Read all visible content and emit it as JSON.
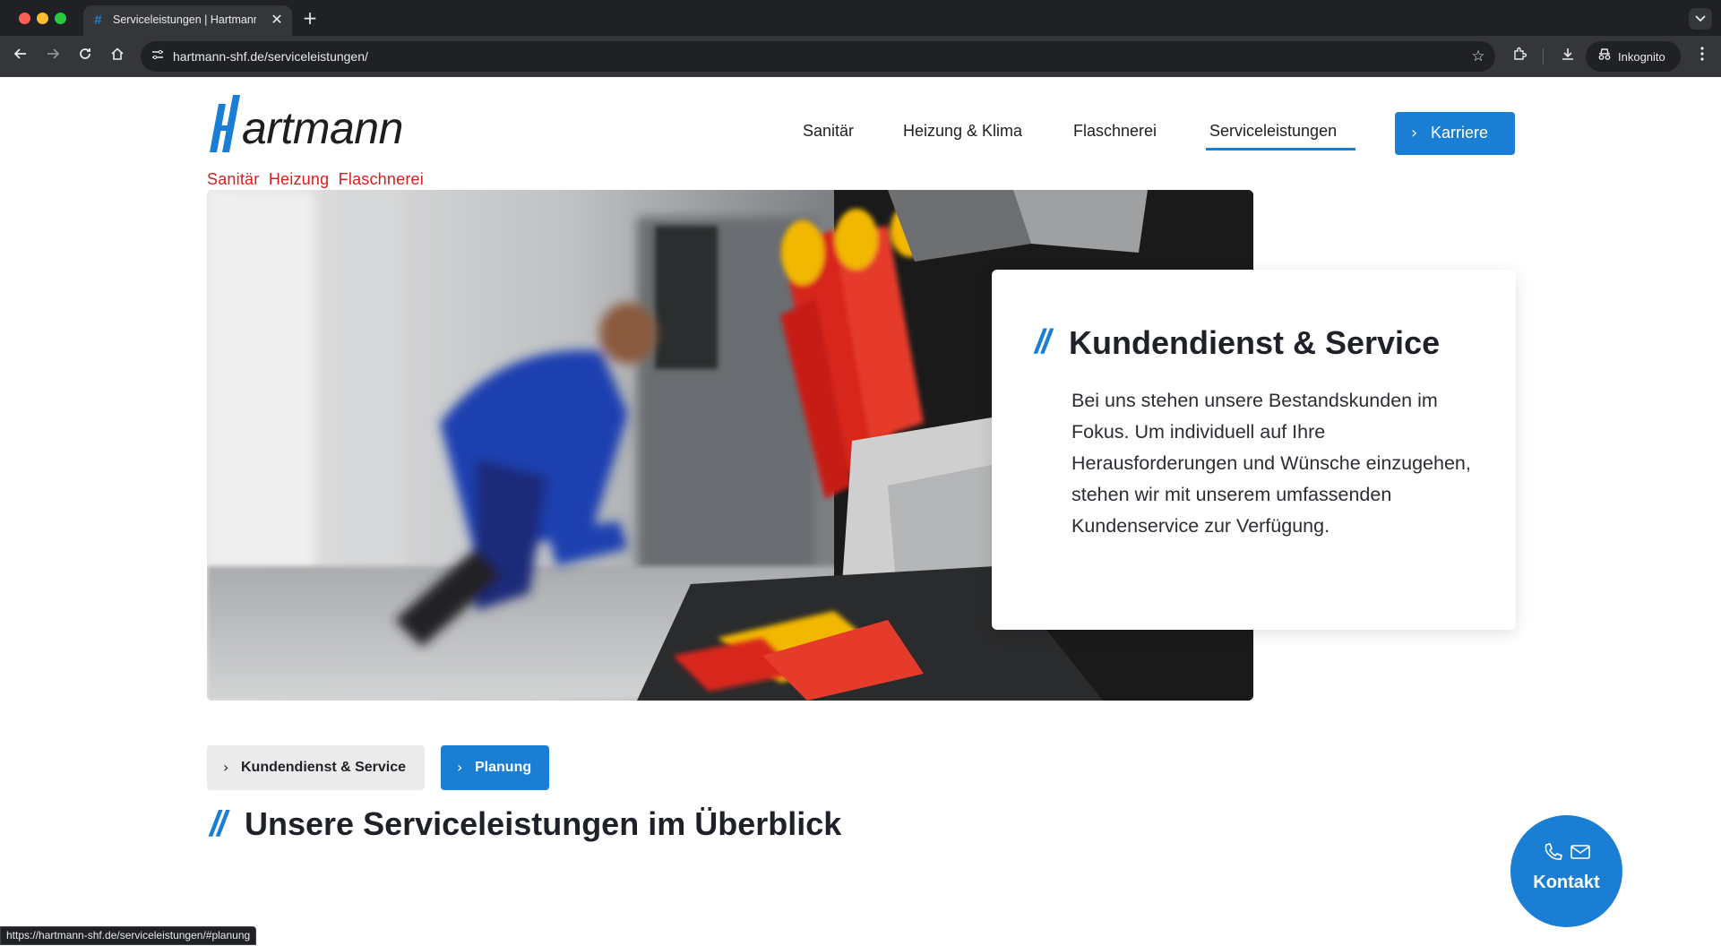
{
  "browser": {
    "tab_title": "Serviceleistungen | Hartmann",
    "tab_close": "✕",
    "new_tab": "+",
    "url": "hartmann-shf.de/serviceleistungen/",
    "incognito_label": "Inkognito",
    "status_url": "https://hartmann-shf.de/serviceleistungen/#planung"
  },
  "header": {
    "logo_word": "Hartmann",
    "logo_tagline": "Sanitär  Heizung  Flaschnerei",
    "nav": [
      {
        "label": "Sanitär"
      },
      {
        "label": "Heizung & Klima"
      },
      {
        "label": "Flaschnerei"
      },
      {
        "label": "Serviceleistungen",
        "active": true
      }
    ],
    "cta_label": "Karriere"
  },
  "hero": {
    "slashes": "//",
    "title": "Kundendienst & Service",
    "text": "Bei uns stehen unsere Bestandskunden im Fokus. Um individuell auf Ihre Herausforderungen und Wünsche einzugehen, stehen wir mit unserem umfassenden Kundenservice zur Verfügung."
  },
  "subnav": {
    "buttons": [
      {
        "label": "Kundendienst & Service"
      },
      {
        "label": "Planung"
      }
    ]
  },
  "section": {
    "slashes": "//",
    "title": "Unsere Serviceleistungen im Überblick"
  },
  "contact_fab": {
    "label": "Kontakt"
  },
  "colors": {
    "brand_blue": "#1a7fd4",
    "brand_red": "#d81e1e",
    "text_dark": "#1e2228"
  },
  "icons": [
    "back-icon",
    "forward-icon",
    "reload-icon",
    "home-icon",
    "site-settings-icon",
    "star-icon",
    "extensions-icon",
    "download-icon",
    "incognito-icon",
    "menu-icon",
    "chevron-right-icon",
    "phone-icon",
    "mail-icon"
  ]
}
